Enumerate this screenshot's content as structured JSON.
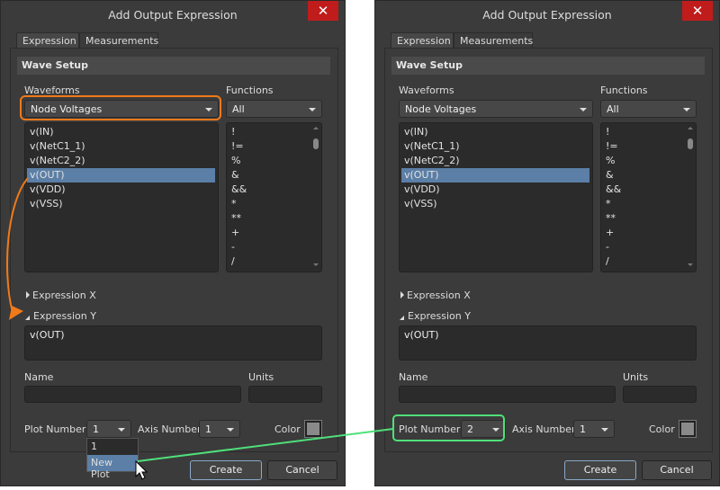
{
  "dialogs": [
    {
      "title": "Add Output Expression",
      "close": "✕",
      "tabs": [
        "Expression",
        "Measurements"
      ],
      "section": "Wave Setup",
      "waveforms_label": "Waveforms",
      "waveform_type": "Node Voltages",
      "functions_label": "Functions",
      "function_filter": "All",
      "waveforms": [
        "v(IN)",
        "v(NetC1_1)",
        "v(NetC2_2)",
        "v(OUT)",
        "v(VDD)",
        "v(VSS)"
      ],
      "selected_waveform": 3,
      "functions": [
        "!",
        "!=",
        "%",
        "&",
        "&&",
        "*",
        "**",
        "+",
        "-",
        "/"
      ],
      "expr_x": "Expression X",
      "expr_y": "Expression Y",
      "expr_y_value": "v(OUT)",
      "name_label": "Name",
      "units_label": "Units",
      "name_value": "",
      "units_value": "",
      "plot_label": "Plot Number",
      "plot_value": "1",
      "axis_label": "Axis Number",
      "axis_value": "1",
      "color_label": "Color",
      "create": "Create",
      "cancel": "Cancel",
      "dropdown": [
        "1",
        "New Plot"
      ],
      "dropdown_selected": 1
    },
    {
      "title": "Add Output Expression",
      "close": "✕",
      "tabs": [
        "Expression",
        "Measurements"
      ],
      "section": "Wave Setup",
      "waveforms_label": "Waveforms",
      "waveform_type": "Node Voltages",
      "functions_label": "Functions",
      "function_filter": "All",
      "waveforms": [
        "v(IN)",
        "v(NetC1_1)",
        "v(NetC2_2)",
        "v(OUT)",
        "v(VDD)",
        "v(VSS)"
      ],
      "selected_waveform": 3,
      "functions": [
        "!",
        "!=",
        "%",
        "&",
        "&&",
        "*",
        "**",
        "+",
        "-",
        "/"
      ],
      "expr_x": "Expression X",
      "expr_y": "Expression Y",
      "expr_y_value": "v(OUT)",
      "name_label": "Name",
      "units_label": "Units",
      "name_value": "",
      "units_value": "",
      "plot_label": "Plot Number",
      "plot_value": "2",
      "axis_label": "Axis Number",
      "axis_value": "1",
      "color_label": "Color",
      "create": "Create",
      "cancel": "Cancel"
    }
  ],
  "annotation_colors": {
    "orange": "#f07a1a",
    "green": "#4fe07a"
  }
}
